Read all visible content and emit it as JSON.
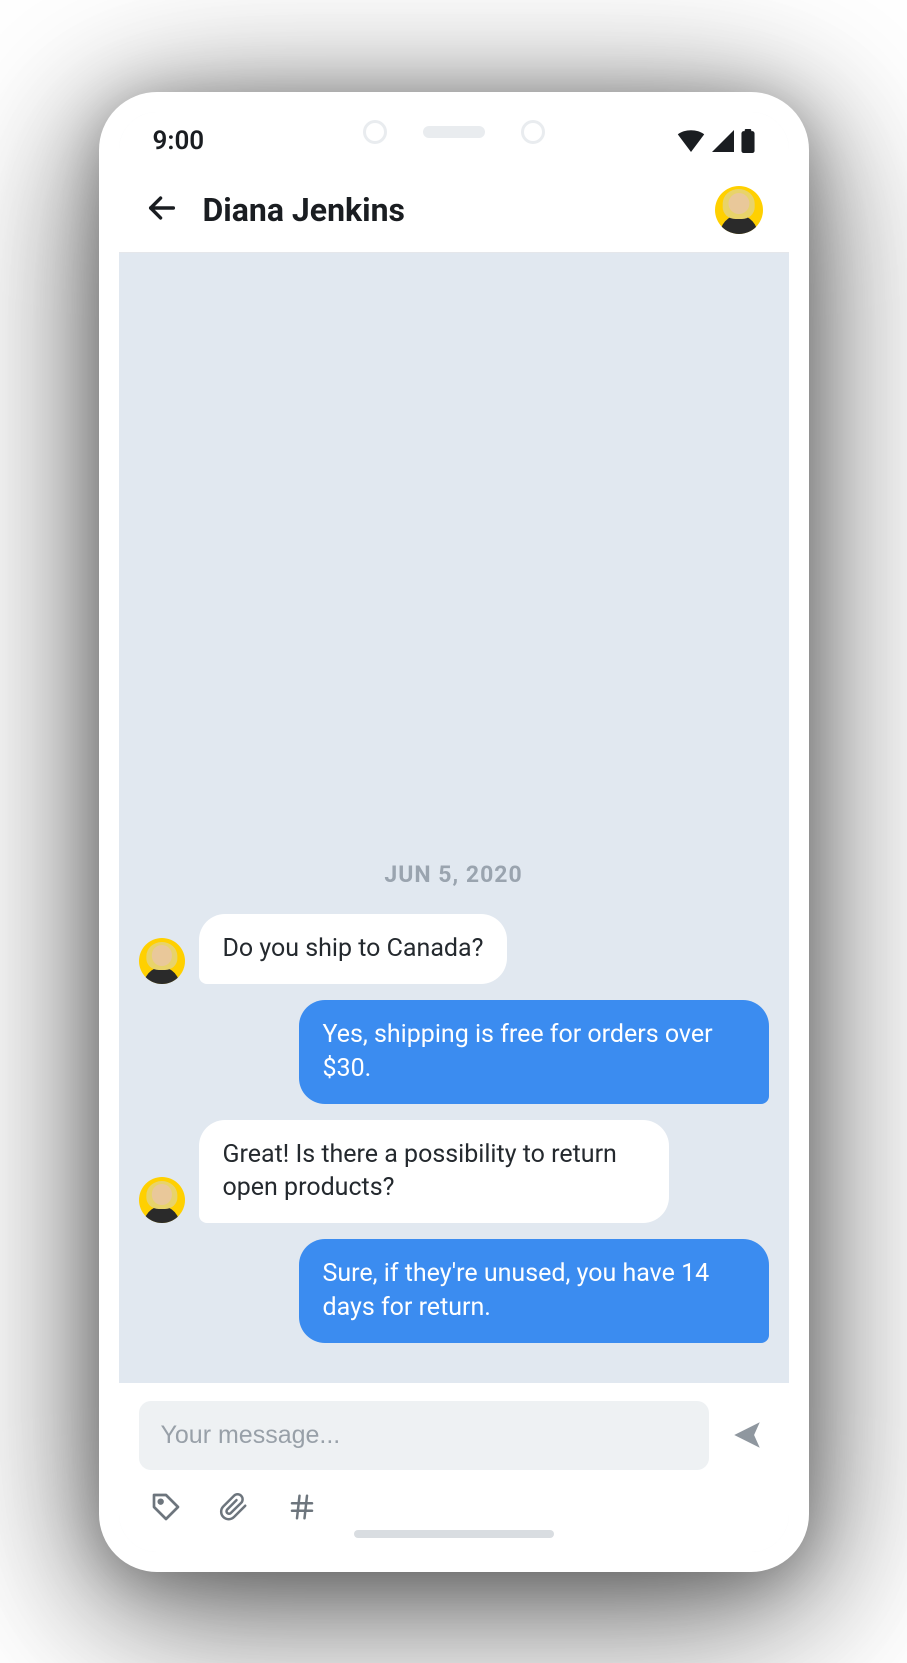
{
  "status": {
    "time": "9:00"
  },
  "header": {
    "title": "Diana Jenkins"
  },
  "chat": {
    "date": "JUN 5, 2020",
    "messages": [
      {
        "side": "in",
        "text": "Do you ship to Canada?",
        "showAvatar": true
      },
      {
        "side": "out",
        "text": "Yes, shipping is free for orders over $30."
      },
      {
        "side": "in",
        "text": "Great! Is there a possibility to return open products?",
        "showAvatar": true
      },
      {
        "side": "out",
        "text": "Sure, if they're unused, you have 14 days for return."
      }
    ]
  },
  "composer": {
    "placeholder": "Your message..."
  }
}
